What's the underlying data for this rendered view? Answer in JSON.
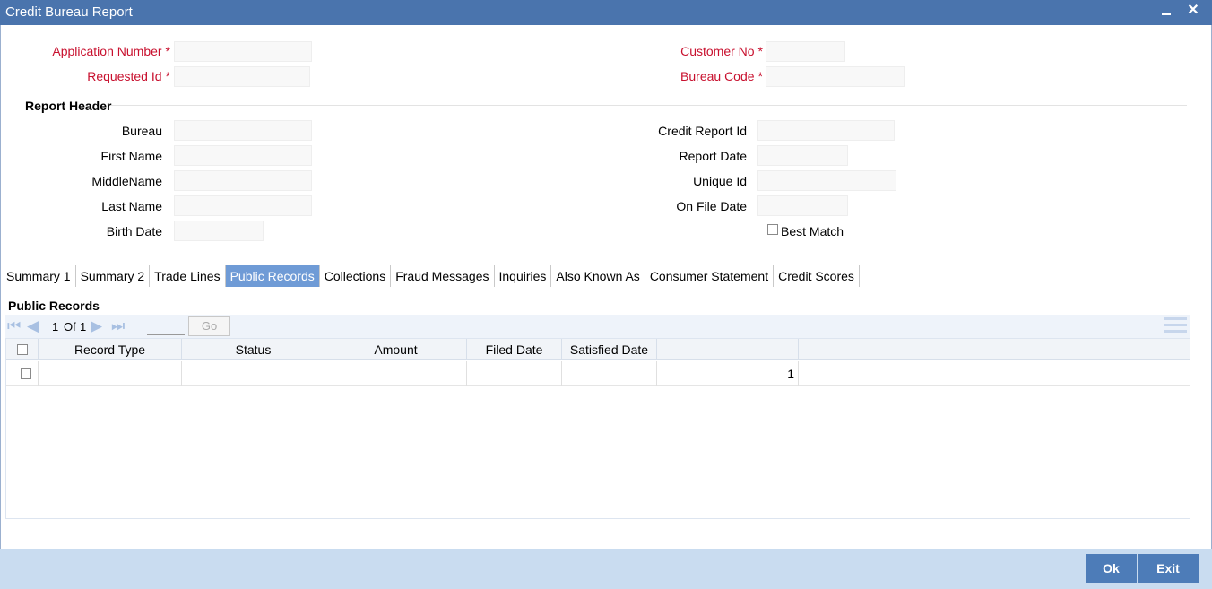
{
  "window": {
    "title": "Credit Bureau Report"
  },
  "fields": {
    "application_number": {
      "label": "Application Number",
      "value": ""
    },
    "requested_id": {
      "label": "Requested Id",
      "value": ""
    },
    "customer_no": {
      "label": "Customer No",
      "value": ""
    },
    "bureau_code": {
      "label": "Bureau Code",
      "value": ""
    },
    "required_mark": "*"
  },
  "report_header": {
    "title": "Report Header",
    "bureau": {
      "label": "Bureau",
      "value": ""
    },
    "first_name": {
      "label": "First Name",
      "value": ""
    },
    "middle_name": {
      "label": "MiddleName",
      "value": ""
    },
    "last_name": {
      "label": "Last Name",
      "value": ""
    },
    "birth_date": {
      "label": "Birth Date",
      "value": ""
    },
    "credit_report_id": {
      "label": "Credit Report Id",
      "value": ""
    },
    "report_date": {
      "label": "Report Date",
      "value": ""
    },
    "unique_id": {
      "label": "Unique Id",
      "value": ""
    },
    "on_file_date": {
      "label": "On File Date",
      "value": ""
    },
    "best_match": {
      "label": "Best Match",
      "checked": false
    }
  },
  "tabs": [
    {
      "label": "Summary 1",
      "active": false
    },
    {
      "label": "Summary 2",
      "active": false
    },
    {
      "label": "Trade Lines",
      "active": false
    },
    {
      "label": "Public Records",
      "active": true
    },
    {
      "label": "Collections",
      "active": false
    },
    {
      "label": "Fraud Messages",
      "active": false
    },
    {
      "label": "Inquiries",
      "active": false
    },
    {
      "label": "Also Known As",
      "active": false
    },
    {
      "label": "Consumer Statement",
      "active": false
    },
    {
      "label": "Credit Scores",
      "active": false
    }
  ],
  "public_records": {
    "title": "Public Records",
    "pager": {
      "current": "1",
      "of_label": "Of",
      "total": "1",
      "go_label": "Go"
    },
    "columns": [
      "Record Type",
      "Status",
      "Amount",
      "Filed Date",
      "Satisfied Date"
    ],
    "rows": [
      {
        "record_type": "",
        "status": "",
        "amount": "",
        "filed_date": "",
        "satisfied_date": "",
        "index": "1"
      }
    ]
  },
  "footer": {
    "ok_label": "Ok",
    "exit_label": "Exit"
  },
  "colors": {
    "titlebar": "#4a74ad",
    "required_label": "#c8102e",
    "active_tab": "#6f9bd6",
    "footer": "#c9dcf0",
    "button": "#4d7cb8"
  }
}
